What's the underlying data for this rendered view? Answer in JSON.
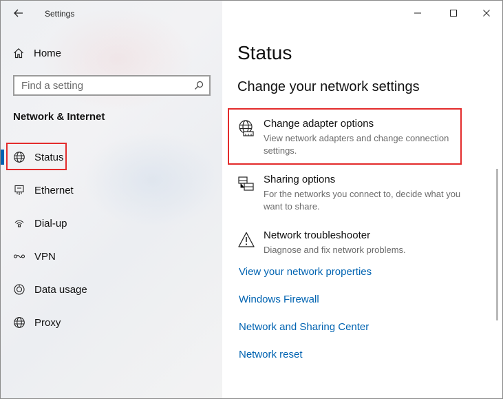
{
  "window": {
    "title": "Settings",
    "controls": [
      "minimize",
      "maximize",
      "close"
    ]
  },
  "sidebar": {
    "home_label": "Home",
    "search_placeholder": "Find a setting",
    "section_heading": "Network & Internet",
    "items": [
      {
        "label": "Status",
        "icon": "globe-icon",
        "active": true
      },
      {
        "label": "Ethernet",
        "icon": "ethernet-icon",
        "active": false
      },
      {
        "label": "Dial-up",
        "icon": "dial-up-icon",
        "active": false
      },
      {
        "label": "VPN",
        "icon": "vpn-icon",
        "active": false
      },
      {
        "label": "Data usage",
        "icon": "data-usage-icon",
        "active": false
      },
      {
        "label": "Proxy",
        "icon": "globe-icon",
        "active": false
      }
    ]
  },
  "main": {
    "page_title": "Status",
    "subtitle": "Change your network settings",
    "options": [
      {
        "title": "Change adapter options",
        "description": "View network adapters and change connection settings.",
        "icon": "adapter-icon"
      },
      {
        "title": "Sharing options",
        "description": "For the networks you connect to, decide what you want to share.",
        "icon": "sharing-icon"
      },
      {
        "title": "Network troubleshooter",
        "description": "Diagnose and fix network problems.",
        "icon": "warning-icon"
      }
    ],
    "links": [
      "View your network properties",
      "Windows Firewall",
      "Network and Sharing Center",
      "Network reset"
    ]
  },
  "colors": {
    "accent": "#0063b1",
    "highlight": "#e32b2b"
  }
}
